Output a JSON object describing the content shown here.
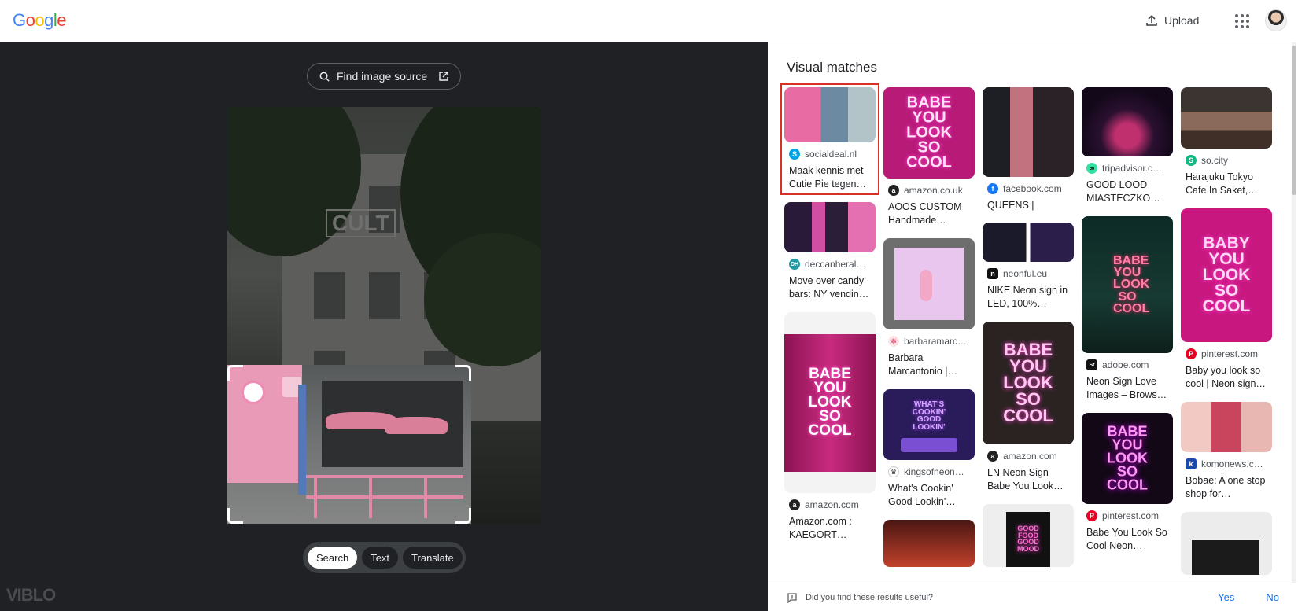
{
  "header": {
    "logo": "Google",
    "upload_label": "Upload"
  },
  "left": {
    "find_source_label": "Find image source",
    "modes": [
      "Search",
      "Text",
      "Translate"
    ],
    "active_mode": "Search",
    "watermark": "VIBLO",
    "photo_sign": "CULT"
  },
  "right": {
    "title": "Visual matches",
    "columns": [
      [
        {
          "site": "socialdeal.nl",
          "title": "Maak kennis met Cutie Pie tegen…",
          "fav_color": "#00a2e8",
          "fav_letter": "S",
          "selected": true
        },
        {
          "site": "deccanheral…",
          "title": "Move over candy bars: NY vendin…",
          "fav_color": "#1c9ca3",
          "fav_letter": "DH"
        },
        {
          "site": "amazon.com",
          "title": "Amazon.com : KAEGORT…",
          "fav_color": "#222222",
          "fav_letter": "a"
        }
      ],
      [
        {
          "site": "amazon.co.uk",
          "title": "AOOS CUSTOM Handmade…",
          "fav_color": "#222222",
          "fav_letter": "a",
          "neon": "BABE YOU LOOK SO COOL"
        },
        {
          "site": "barbaramarc…",
          "title": "Barbara Marcantonio |…",
          "fav_color": "#e25a7a",
          "fav_letter": "✽"
        },
        {
          "site": "kingsofneon…",
          "title": "What's Cookin' Good Lookin'…",
          "fav_color": "#333333",
          "fav_letter": "♛",
          "neon": "WHAT'S COOKIN' GOOD LOOKIN'"
        }
      ],
      [
        {
          "site": "facebook.com",
          "title": "QUEENS | London",
          "fav_color": "#1877f2",
          "fav_letter": "f"
        },
        {
          "site": "neonful.eu",
          "title": "NIKE Neon sign in LED, 100%…",
          "fav_color": "#111111",
          "fav_letter": "n"
        },
        {
          "site": "amazon.com",
          "title": "LN Neon Sign Babe You Look…",
          "fav_color": "#222222",
          "fav_letter": "a",
          "neon": "BABE YOU LOOK SO COOL"
        },
        {
          "site": "",
          "title": "",
          "neon": "GOOD FOOD GOOD MOOD"
        }
      ],
      [
        {
          "site": "tripadvisor.c…",
          "title": "GOOD LOOD MIASTECZKO…",
          "fav_color": "#34e0a1",
          "fav_letter": "∞"
        },
        {
          "site": "adobe.com",
          "title": "Neon Sign Love Images – Brows…",
          "fav_color": "#111111",
          "fav_letter": "St",
          "neon": "BABE YOU LOOK SO COOL"
        },
        {
          "site": "pinterest.com",
          "title": "Babe You Look So Cool Neon…",
          "fav_color": "#e60023",
          "fav_letter": "P",
          "neon": "BABE YOU LOOK SO COOL"
        }
      ],
      [
        {
          "site": "so.city",
          "title": "Harajuku Tokyo Cafe In Saket,…",
          "fav_color": "#10b981",
          "fav_letter": "S"
        },
        {
          "site": "pinterest.com",
          "title": "Baby you look so cool | Neon sign…",
          "fav_color": "#e60023",
          "fav_letter": "P",
          "neon": "BABY YOU LOOK SO COOL"
        },
        {
          "site": "komonews.c…",
          "title": "Bobae: A one stop shop for…",
          "fav_color": "#1b4aa8",
          "fav_letter": "k"
        }
      ]
    ],
    "feedback": {
      "question": "Did you find these results useful?",
      "yes": "Yes",
      "no": "No"
    }
  }
}
